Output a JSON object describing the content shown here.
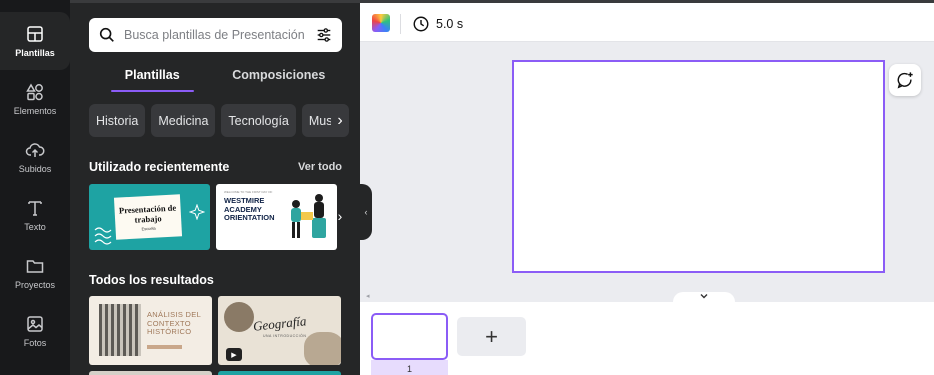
{
  "rail": {
    "items": [
      {
        "label": "Plantillas",
        "icon": "layout-icon",
        "active": true
      },
      {
        "label": "Elementos",
        "icon": "shapes-icon"
      },
      {
        "label": "Subidos",
        "icon": "cloud-upload-icon"
      },
      {
        "label": "Texto",
        "icon": "text-icon"
      },
      {
        "label": "Proyectos",
        "icon": "folder-icon"
      },
      {
        "label": "Fotos",
        "icon": "image-icon"
      }
    ]
  },
  "search": {
    "placeholder": "Busca plantillas de Presentación",
    "icon": "search-icon",
    "filter_icon": "sliders-icon"
  },
  "tabs": [
    {
      "label": "Plantillas",
      "active": true
    },
    {
      "label": "Composiciones"
    }
  ],
  "chips": [
    "Historia",
    "Medicina",
    "Tecnología",
    "Music"
  ],
  "recent": {
    "title": "Utilizado recientemente",
    "see_all": "Ver todo",
    "items": [
      {
        "title": "Presentación de trabajo",
        "subtitle": "Escuela"
      },
      {
        "title": "WESTMIRE ACADEMY ORIENTATION",
        "small": "WELCOME TO THE FIRST DAY OF"
      }
    ]
  },
  "results": {
    "title": "Todos los resultados",
    "items": [
      {
        "title": "ANÁLISIS DEL CONTEXTO HISTÓRICO"
      },
      {
        "title": "Geografía",
        "subtitle": "UNA INTRODUCCIÓN"
      }
    ]
  },
  "editor": {
    "duration": "5.0 s",
    "page_number": "1",
    "add_page_symbol": "+",
    "accent": "#8b5cf6"
  }
}
